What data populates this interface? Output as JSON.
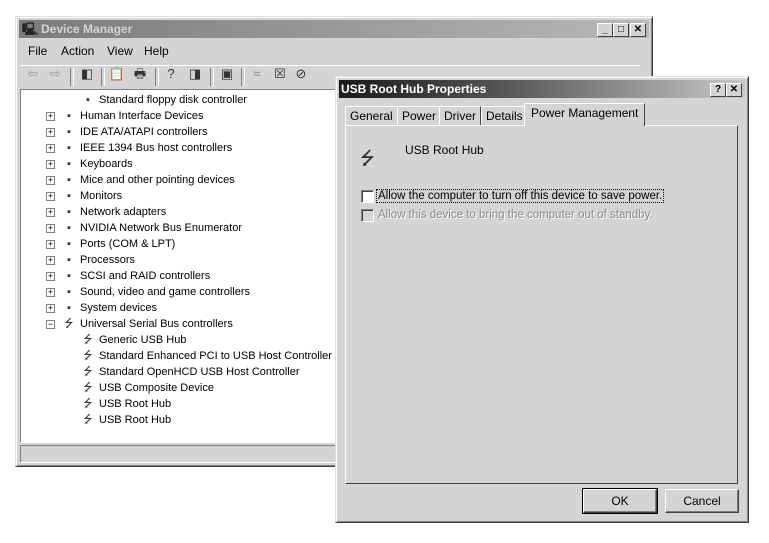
{
  "device_manager": {
    "title": "Device Manager",
    "menu": [
      "File",
      "Action",
      "View",
      "Help"
    ],
    "toolbar_icons": [
      "back-icon",
      "forward-icon",
      "show-hide-tree-icon",
      "properties-icon",
      "print-icon",
      "help-icon",
      "show-hide-action-pane-icon",
      "scan-hardware-icon",
      "update-driver-icon",
      "uninstall-icon",
      "disable-icon"
    ],
    "tree": [
      {
        "label": "Standard floppy disk controller",
        "level": 2,
        "icon": "floppy-controller-icon"
      },
      {
        "label": "Human Interface Devices",
        "level": 1,
        "expander": "+",
        "icon": "hid-icon"
      },
      {
        "label": "IDE ATA/ATAPI controllers",
        "level": 1,
        "expander": "+",
        "icon": "ide-icon"
      },
      {
        "label": "IEEE 1394 Bus host controllers",
        "level": 1,
        "expander": "+",
        "icon": "firewire-icon"
      },
      {
        "label": "Keyboards",
        "level": 1,
        "expander": "+",
        "icon": "keyboard-icon"
      },
      {
        "label": "Mice and other pointing devices",
        "level": 1,
        "expander": "+",
        "icon": "mouse-icon"
      },
      {
        "label": "Monitors",
        "level": 1,
        "expander": "+",
        "icon": "monitor-icon"
      },
      {
        "label": "Network adapters",
        "level": 1,
        "expander": "+",
        "icon": "network-icon"
      },
      {
        "label": "NVIDIA Network Bus Enumerator",
        "level": 1,
        "expander": "+",
        "icon": "bus-icon"
      },
      {
        "label": "Ports (COM & LPT)",
        "level": 1,
        "expander": "+",
        "icon": "port-icon"
      },
      {
        "label": "Processors",
        "level": 1,
        "expander": "+",
        "icon": "cpu-icon"
      },
      {
        "label": "SCSI and RAID controllers",
        "level": 1,
        "expander": "+",
        "icon": "scsi-icon"
      },
      {
        "label": "Sound, video and game controllers",
        "level": 1,
        "expander": "+",
        "icon": "sound-icon"
      },
      {
        "label": "System devices",
        "level": 1,
        "expander": "+",
        "icon": "system-icon"
      },
      {
        "label": "Universal Serial Bus controllers",
        "level": 1,
        "expander": "-",
        "icon": "usb-icon"
      },
      {
        "label": "Generic USB Hub",
        "level": 2,
        "icon": "usb-icon"
      },
      {
        "label": "Standard Enhanced PCI to USB Host Controller",
        "level": 2,
        "icon": "usb-icon"
      },
      {
        "label": "Standard OpenHCD USB Host Controller",
        "level": 2,
        "icon": "usb-icon"
      },
      {
        "label": "USB Composite Device",
        "level": 2,
        "icon": "usb-icon"
      },
      {
        "label": "USB Root Hub",
        "level": 2,
        "icon": "usb-icon"
      },
      {
        "label": "USB Root Hub",
        "level": 2,
        "icon": "usb-icon"
      }
    ]
  },
  "dialog": {
    "title": "USB Root Hub Properties",
    "tabs": [
      "General",
      "Power",
      "Driver",
      "Details",
      "Power Management"
    ],
    "active_tab": "Power Management",
    "device_name": "USB Root Hub",
    "options": [
      {
        "label": "Allow the computer to turn off this device to save power.",
        "checked": false,
        "enabled": true
      },
      {
        "label": "Allow this device to bring the computer out of standby.",
        "checked": false,
        "enabled": false
      }
    ],
    "ok_label": "OK",
    "cancel_label": "Cancel",
    "help_glyph": "?",
    "close_glyph": "✕"
  }
}
